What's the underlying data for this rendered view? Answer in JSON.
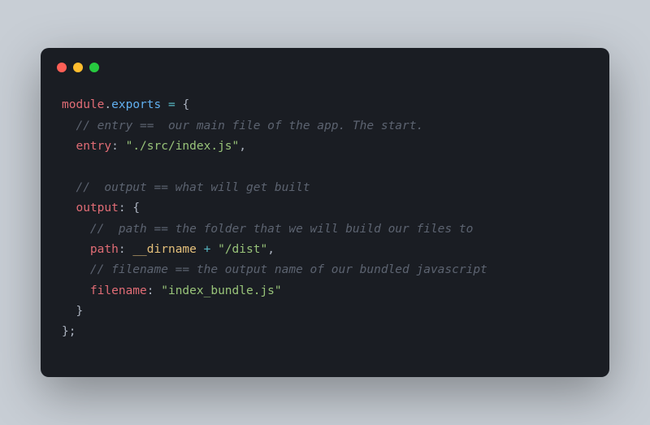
{
  "code": {
    "line1": {
      "module": "module",
      "dot": ".",
      "exports": "exports",
      "equals": " = ",
      "brace": "{"
    },
    "line2": {
      "indent": "  ",
      "comment": "// entry ==  our main file of the app. The start."
    },
    "line3": {
      "indent": "  ",
      "key": "entry",
      "colon": ": ",
      "value": "\"./src/index.js\"",
      "comma": ","
    },
    "line4": "",
    "line5": {
      "indent": "  ",
      "comment": "//  output == what will get built"
    },
    "line6": {
      "indent": "  ",
      "key": "output",
      "colon": ": ",
      "brace": "{"
    },
    "line7": {
      "indent": "    ",
      "comment": "//  path == the folder that we will build our files to"
    },
    "line8": {
      "indent": "    ",
      "key": "path",
      "colon": ": ",
      "dirname": "__dirname",
      "plus": " + ",
      "value": "\"/dist\"",
      "comma": ","
    },
    "line9": {
      "indent": "    ",
      "comment": "// filename == the output name of our bundled javascript"
    },
    "line10": {
      "indent": "    ",
      "key": "filename",
      "colon": ": ",
      "value": "\"index_bundle.js\""
    },
    "line11": {
      "indent": "  ",
      "brace": "}"
    },
    "line12": {
      "brace": "};"
    }
  }
}
